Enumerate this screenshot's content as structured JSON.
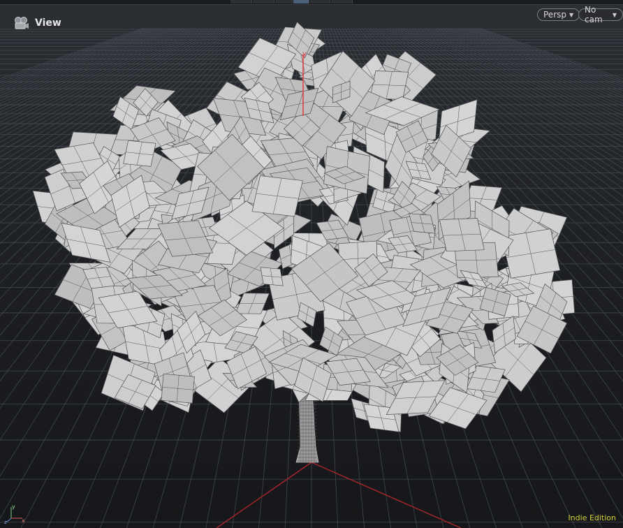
{
  "viewport": {
    "title": "View",
    "camera_icon": "camera-icon",
    "persp_label": "Persp",
    "cam_label": "No cam",
    "edition": "Indie Edition",
    "axis_y_label": "y",
    "gizmo_labels": {
      "x": "x",
      "y": "y",
      "z": "z"
    }
  },
  "colors": {
    "grid": "#4a4e55",
    "leaf_fill": "#c9c9c9",
    "leaf_stroke": "#4d4f53",
    "x_axis": "#a3262a",
    "y_axis": "#e03a3a",
    "edition_text": "#d6d23a"
  }
}
